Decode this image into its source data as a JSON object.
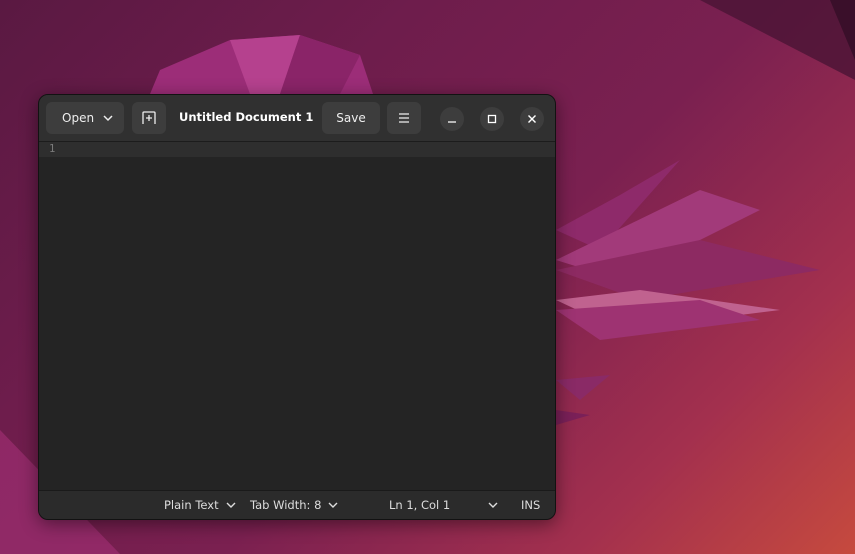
{
  "window": {
    "title": "Untitled Document 1",
    "open_label": "Open",
    "save_label": "Save"
  },
  "editor": {
    "line_numbers": [
      "1"
    ],
    "content": ""
  },
  "statusbar": {
    "language": "Plain Text",
    "tab_width": "Tab Width: 8",
    "cursor_position": "Ln 1, Col 1",
    "insert_mode": "INS"
  },
  "icons": {
    "open_dropdown": "chevron-down-icon",
    "new_tab": "new-tab-icon",
    "menu": "hamburger-menu-icon",
    "minimize": "minimize-icon",
    "maximize": "maximize-icon",
    "close": "close-icon"
  },
  "colors": {
    "desktop_accent": "#7a2050",
    "window_bg": "#242424",
    "headerbar_bg": "#303030",
    "button_bg": "#3d3d3d"
  }
}
